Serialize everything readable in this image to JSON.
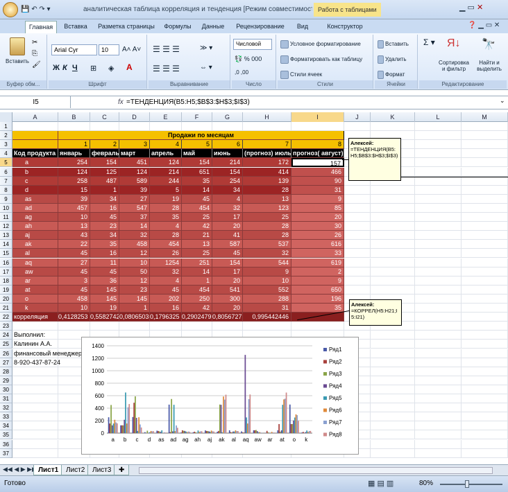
{
  "window": {
    "title": "аналитическая таблица корреляция и тенденция  [Режим совместимости] - Microsoft Excel",
    "context_tab": "Работа с таблицами"
  },
  "tabs": [
    "Главная",
    "Вставка",
    "Разметка страницы",
    "Формулы",
    "Данные",
    "Рецензирование",
    "Вид",
    "Конструктор"
  ],
  "ribbon": {
    "groups": [
      "Буфер обм...",
      "Шрифт",
      "Выравнивание",
      "Число",
      "Стили",
      "Ячейки",
      "Редактирование"
    ],
    "paste": "Вставить",
    "font_name": "Arial Cyr",
    "font_size": "10",
    "number_format": "Числовой",
    "cond_format": "Условное форматирование",
    "format_table": "Форматировать как таблицу",
    "cell_styles": "Стили ячеек",
    "insert": "Вставить",
    "delete": "Удалить",
    "format": "Формат",
    "sort": "Сортировка и фильтр",
    "find": "Найти и выделить",
    "bold": "Ж",
    "italic": "К",
    "underline": "Ч"
  },
  "formula_bar": {
    "name_box": "I5",
    "fx": "fx",
    "formula": "=ТЕНДЕНЦИЯ(B5:H5;$B$3:$H$3;$I$3)"
  },
  "columns": [
    "A",
    "B",
    "C",
    "D",
    "E",
    "F",
    "G",
    "H",
    "I",
    "J",
    "K",
    "L",
    "M"
  ],
  "rows": [
    "1",
    "2",
    "3",
    "4",
    "5",
    "6",
    "7",
    "8",
    "9",
    "10",
    "11",
    "12",
    "13",
    "14",
    "15",
    "16",
    "17",
    "18",
    "19",
    "20",
    "21",
    "22",
    "23",
    "24",
    "25",
    "26",
    "27",
    "28",
    "29",
    "30",
    "31",
    "32",
    "33",
    "34",
    "35",
    "36",
    "37"
  ],
  "table": {
    "banner": "Продажи по месяцам",
    "month_numbers": [
      "1",
      "2",
      "3",
      "4",
      "5",
      "6",
      "7",
      "8"
    ],
    "headers": [
      "Код продукта",
      "январь",
      "февраль",
      "март",
      "апрель",
      "май",
      "июнь",
      "(прогноз) июль",
      "прогноз( август)"
    ],
    "body": [
      [
        "a",
        "254",
        "154",
        "451",
        "124",
        "154",
        "214",
        "172",
        "157"
      ],
      [
        "b",
        "124",
        "125",
        "124",
        "214",
        "651",
        "154",
        "414",
        "466"
      ],
      [
        "c",
        "258",
        "487",
        "589",
        "244",
        "35",
        "254",
        "139",
        "90"
      ],
      [
        "d",
        "15",
        "1",
        "39",
        "5",
        "14",
        "34",
        "28",
        "31"
      ],
      [
        "as",
        "39",
        "34",
        "27",
        "19",
        "45",
        "4",
        "13",
        "9"
      ],
      [
        "ad",
        "457",
        "16",
        "547",
        "28",
        "454",
        "32",
        "123",
        "85"
      ],
      [
        "ag",
        "10",
        "45",
        "37",
        "35",
        "25",
        "17",
        "25",
        "20"
      ],
      [
        "ah",
        "13",
        "23",
        "14",
        "4",
        "42",
        "20",
        "28",
        "30"
      ],
      [
        "aj",
        "43",
        "34",
        "32",
        "28",
        "21",
        "41",
        "28",
        "26"
      ],
      [
        "ak",
        "22",
        "35",
        "458",
        "454",
        "13",
        "587",
        "537",
        "616"
      ],
      [
        "al",
        "45",
        "16",
        "12",
        "26",
        "25",
        "45",
        "32",
        "33"
      ],
      [
        "aq",
        "27",
        "11",
        "10",
        "1254",
        "251",
        "154",
        "544",
        "619"
      ],
      [
        "aw",
        "45",
        "45",
        "50",
        "32",
        "14",
        "17",
        "9",
        "2"
      ],
      [
        "ar",
        "3",
        "36",
        "12",
        "4",
        "1",
        "20",
        "10",
        "9"
      ],
      [
        "at",
        "45",
        "145",
        "23",
        "45",
        "454",
        "541",
        "552",
        "650"
      ],
      [
        "o",
        "458",
        "145",
        "145",
        "202",
        "250",
        "300",
        "288",
        "196"
      ],
      [
        "k",
        "10",
        "19",
        "1",
        "16",
        "42",
        "20",
        "31",
        "35"
      ]
    ],
    "corr_row": [
      "корреляция",
      "0,4128253",
      "0,5582742",
      "0,0806503",
      "0,1796325",
      "0,2902479",
      "0,8056727",
      "0,995442446",
      ""
    ]
  },
  "author": [
    "Выполнил:",
    "Калинин А.А.",
    "финансовый менеджер",
    "8-920-437-87-24"
  ],
  "comments": [
    {
      "author": "Алексей:",
      "text": "=ТЕНДЕНЦИЯ(B5:H5;$B$3:$H$3;$I$3)"
    },
    {
      "author": "Алексей:",
      "text": "=КОРРЕЛ(H5:H21;I5:I21)"
    }
  ],
  "chart_data": {
    "type": "bar",
    "categories": [
      "a",
      "b",
      "c",
      "d",
      "as",
      "ad",
      "ag",
      "ah",
      "aj",
      "ak",
      "al",
      "aq",
      "aw",
      "ar",
      "at",
      "o",
      "k"
    ],
    "ylim": [
      0,
      1400
    ],
    "yticks": [
      "0",
      "200",
      "400",
      "600",
      "800",
      "1000",
      "1200",
      "1400"
    ],
    "legend_position": "right",
    "colors": [
      "#4a5aa8",
      "#a8403c",
      "#8aa548",
      "#6a4a92",
      "#3a9ab2",
      "#e08a3a",
      "#8aa0d0",
      "#d08a8a"
    ],
    "series": [
      {
        "name": "Ряд1",
        "values": [
          254,
          124,
          258,
          15,
          39,
          457,
          10,
          13,
          43,
          22,
          45,
          27,
          45,
          3,
          45,
          458,
          10
        ]
      },
      {
        "name": "Ряд2",
        "values": [
          154,
          125,
          487,
          1,
          34,
          16,
          45,
          23,
          34,
          35,
          16,
          11,
          45,
          36,
          145,
          145,
          19
        ]
      },
      {
        "name": "Ряд3",
        "values": [
          451,
          124,
          589,
          39,
          27,
          547,
          37,
          14,
          32,
          458,
          12,
          10,
          50,
          12,
          23,
          145,
          1
        ]
      },
      {
        "name": "Ряд4",
        "values": [
          124,
          214,
          244,
          5,
          19,
          28,
          35,
          4,
          28,
          454,
          26,
          1254,
          32,
          4,
          45,
          202,
          16
        ]
      },
      {
        "name": "Ряд5",
        "values": [
          154,
          651,
          35,
          14,
          45,
          454,
          25,
          42,
          21,
          13,
          25,
          251,
          14,
          1,
          454,
          250,
          42
        ]
      },
      {
        "name": "Ряд6",
        "values": [
          214,
          154,
          254,
          34,
          4,
          32,
          17,
          20,
          41,
          587,
          45,
          154,
          17,
          20,
          541,
          300,
          20
        ]
      },
      {
        "name": "Ряд7",
        "values": [
          172,
          414,
          139,
          28,
          13,
          123,
          25,
          28,
          28,
          537,
          32,
          544,
          9,
          10,
          552,
          288,
          31
        ]
      },
      {
        "name": "Ряд8",
        "values": [
          157,
          466,
          90,
          31,
          9,
          85,
          20,
          30,
          26,
          616,
          33,
          619,
          2,
          9,
          650,
          196,
          35
        ]
      }
    ]
  },
  "sheets": [
    "Лист1",
    "Лист2",
    "Лист3"
  ],
  "status": {
    "ready": "Готово",
    "zoom": "80%"
  }
}
